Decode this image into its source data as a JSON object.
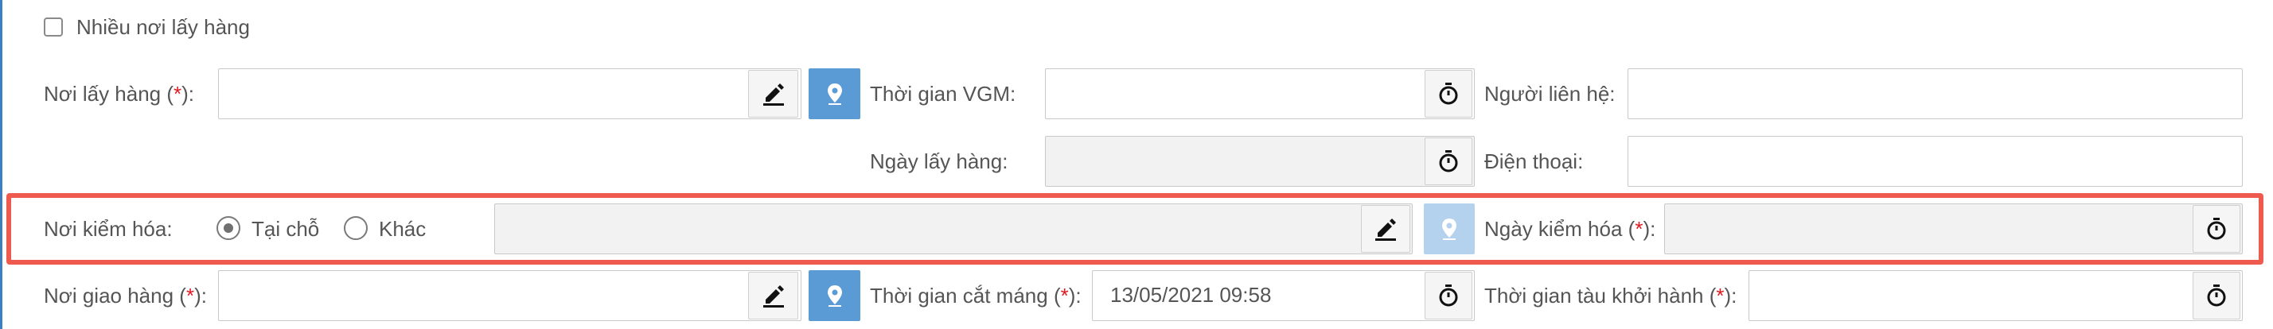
{
  "multi_pickup": {
    "label": "Nhiều nơi lấy hàng",
    "checked": false
  },
  "pickup_place": {
    "label": "Nơi lấy hàng (",
    "req": "*",
    "suffix": "):",
    "value": ""
  },
  "vgm_time": {
    "label": "Thời gian VGM:",
    "value": ""
  },
  "contact_person": {
    "label": "Người liên hệ:",
    "value": ""
  },
  "pickup_date": {
    "label": "Ngày lấy hàng:",
    "value": ""
  },
  "phone": {
    "label": "Điện thoại:",
    "value": ""
  },
  "inspection_place": {
    "label": "Nơi kiểm hóa:",
    "options": [
      "Tại chỗ",
      "Khác"
    ],
    "selected": "Tại chỗ",
    "value": ""
  },
  "inspection_date": {
    "label": "Ngày kiểm hóa (",
    "req": "*",
    "suffix": "):",
    "value": ""
  },
  "delivery_place": {
    "label": "Nơi giao hàng (",
    "req": "*",
    "suffix": "):",
    "value": ""
  },
  "cutoff_time": {
    "label": "Thời gian cắt máng (",
    "req": "*",
    "suffix": "):",
    "value": "13/05/2021 09:58"
  },
  "departure_time": {
    "label": "Thời gian tàu khởi hành (",
    "req": "*",
    "suffix": "):",
    "value": ""
  },
  "icons": {
    "edit": "pencil-icon",
    "map": "map-pin-icon",
    "clock": "stopwatch-icon"
  },
  "colors": {
    "highlight": "#ef5a4e",
    "pin_button": "#5b9bd5",
    "required": "#e0191f"
  }
}
